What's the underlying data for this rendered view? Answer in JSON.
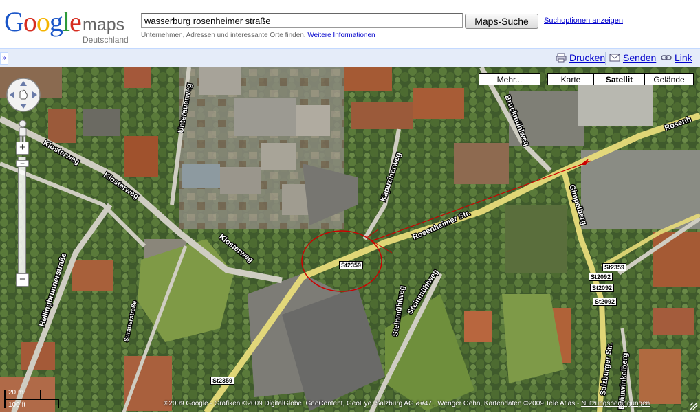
{
  "logo": {
    "google": "Google",
    "maps": "maps",
    "country": "Deutschland"
  },
  "search": {
    "value": "wasserburg rosenheimer straße",
    "button": "Maps-Suche",
    "options_link": "Suchoptionen anzeigen",
    "hint": "Unternehmen, Adressen und interessante Orte finden.",
    "hint_link": "Weitere Informationen"
  },
  "toolbar": {
    "collapse": "»",
    "print": "Drucken",
    "send": "Senden",
    "link": "Link"
  },
  "map_type": {
    "more": "Mehr...",
    "map": "Karte",
    "satellite": "Satellit",
    "terrain": "Gelände"
  },
  "streets": {
    "klosterweg_1": "Klosterweg",
    "klosterweg_2": "Klosterweg",
    "klosterweg_3": "Klosterweg",
    "unterauerweg": "Unterauerweg",
    "kapuzinerweg": "Kapuzinerweg",
    "rosenheimer_1": "Rosenheimer Str.",
    "rosenheimer_2": "Rosenh",
    "bruckmuehlweg": "Bruckmühlweg",
    "gimpelberg": "Gimpelberg",
    "steinmuehlweg_1": "Steinmühlweg",
    "steinmuehlweg_2": "Steinmühlweg",
    "heilingbrunnerstrasse": "Heilingbrunnerstraße",
    "surauerstrasse": "Surauerstraße",
    "salzburger": "Salzburger Str.",
    "brauwinkelberg": "Bräuwinkelberg"
  },
  "shields": {
    "st2359_a": "St2359",
    "st2359_b": "St2359",
    "st2359_c": "St2359",
    "st2092_a": "St2092",
    "st2092_b": "St2092",
    "st2092_c": "St2092"
  },
  "scale": {
    "metric": "20 m",
    "imperial": "100 ft"
  },
  "copyright": {
    "text": "©2009 Google - Grafiken ©2009 DigitalGlobe, GeoContent, GeoEye, Salzburg AG &#47;, Wenger Oehn, Kartendaten ©2009 Tele Atlas -",
    "terms": "Nutzungsbedingungen"
  },
  "colors": {
    "toolbar_bg": "#e5ecf9",
    "link": "#0000cc",
    "road": "#e8dc7a",
    "circle": "#cc0000"
  }
}
